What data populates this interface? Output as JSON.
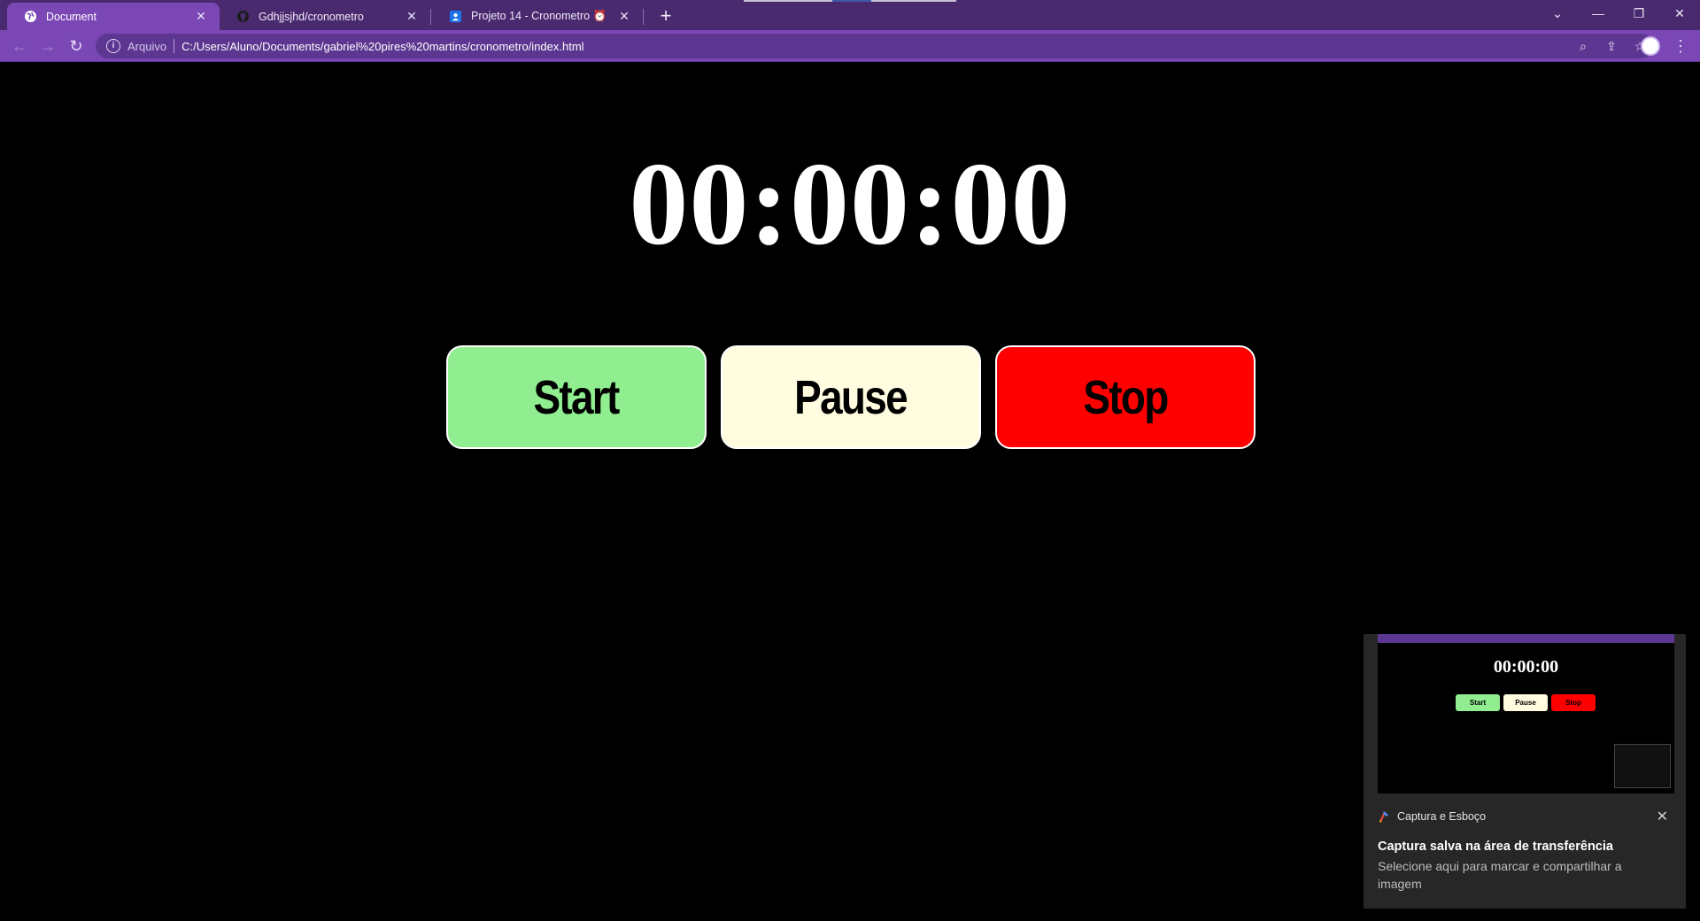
{
  "browser": {
    "tabs": [
      {
        "title": "Document",
        "active": true,
        "icon": "globe-icon"
      },
      {
        "title": "Gdhjjsjhd/cronometro",
        "active": false,
        "icon": "github-icon"
      },
      {
        "title": "Projeto 14 - Cronometro ⏰",
        "active": false,
        "icon": "profile-favicon-icon"
      }
    ],
    "new_tab": "+",
    "omnibox": {
      "label": "Arquivo",
      "url": "C:/Users/Aluno/Documents/gabriel%20pires%20martins/cronometro/index.html"
    },
    "colors": {
      "frame": "#4a2a6e",
      "active_tab": "#7a47b5",
      "omnibox": "#5c3690"
    }
  },
  "page": {
    "timer": "00:00:00",
    "buttons": [
      {
        "label": "Start",
        "color": "#90ee90"
      },
      {
        "label": "Pause",
        "color": "#fffce0"
      },
      {
        "label": "Stop",
        "color": "#ff0000"
      }
    ]
  },
  "toast": {
    "app_name": "Captura e Esboço",
    "title": "Captura salva na área de transferência",
    "body": "Selecione aqui para marcar e compartilhar a imagem",
    "preview": {
      "timer": "00:00:00",
      "buttons": [
        "Start",
        "Pause",
        "Stop"
      ]
    }
  }
}
